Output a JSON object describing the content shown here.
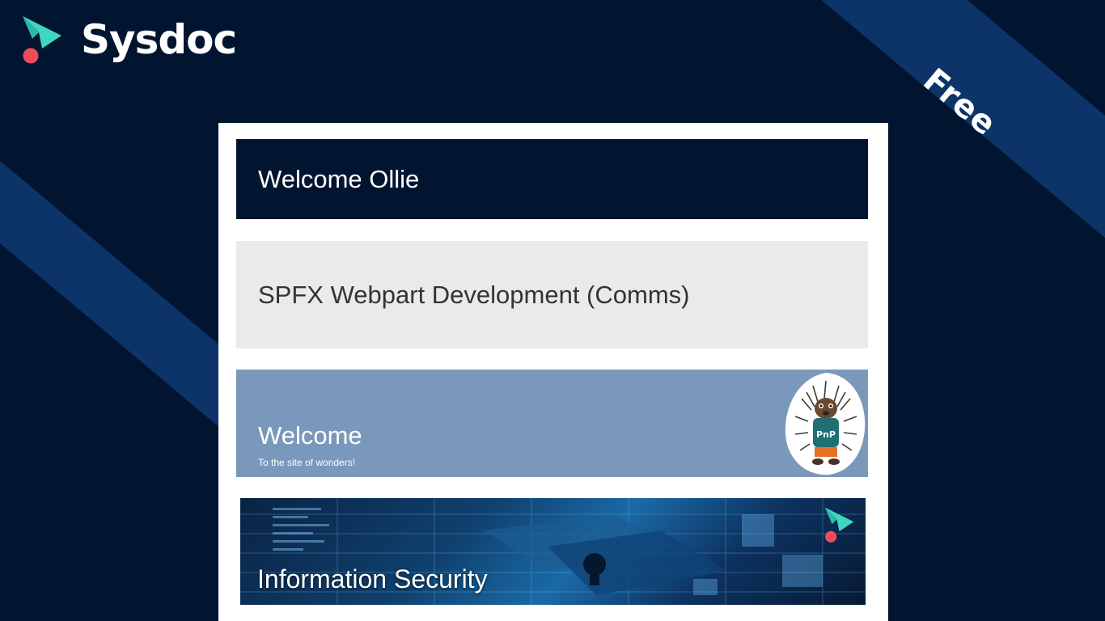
{
  "brand": {
    "name": "Sysdoc",
    "badge": "Free",
    "colors": {
      "background": "#021530",
      "stripe": "#0c3469",
      "logo_teal": "#3fd6c0",
      "logo_red": "#f04b5a"
    }
  },
  "panels": {
    "greeting": {
      "title": "Welcome Ollie"
    },
    "site_title": {
      "title": "SPFX Webpart Development (Comms)"
    },
    "hero": {
      "title": "Welcome",
      "subtitle": "To the site of wonders!",
      "mascot_badge": "PnP",
      "mascot_icon": "pnp-porcupine-mascot-icon"
    },
    "banner": {
      "title": "Information Security",
      "icon": "sysdoc-logo-icon"
    }
  }
}
